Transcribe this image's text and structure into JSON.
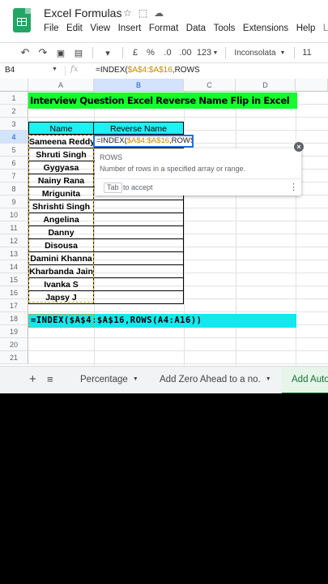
{
  "app": {
    "title": "Excel Formulas",
    "menu": [
      "File",
      "Edit",
      "View",
      "Insert",
      "Format",
      "Data",
      "Tools",
      "Extensions",
      "Help",
      "L"
    ]
  },
  "toolbar": {
    "pound": "£",
    "percent": "%",
    "dec_decrease": ".0",
    "dec_increase": ".00",
    "more_formats": "123",
    "font": "Inconsolata",
    "font_size": "11"
  },
  "formula_bar": {
    "name_box": "B4",
    "fx": "fx",
    "prefix": "=INDEX(",
    "range": "$A$4:$A$16",
    "suffix": ",ROWS"
  },
  "columns": [
    "A",
    "B",
    "C",
    "D"
  ],
  "rows": [
    "1",
    "2",
    "3",
    "4",
    "5",
    "6",
    "7",
    "8",
    "9",
    "10",
    "11",
    "12",
    "13",
    "14",
    "15",
    "16",
    "17",
    "18",
    "19",
    "20",
    "21"
  ],
  "sheet": {
    "banner": "Interview Question Excel Reverse Name Flip in Excel",
    "header_name": "Name",
    "header_reverse": "Reverse Name",
    "names": [
      "Sameena Reddy",
      "Shruti Singh",
      "Gygyasa",
      "Nainy Rana",
      "Mrigunita",
      "Shrishti Singh",
      "Angelina",
      "Danny",
      "Disousa",
      "Damini Khanna",
      "Kharbanda Jain",
      "Ivanka S",
      "Japsy J"
    ],
    "formula_text": "=INDEX($A$4:$A$16,ROWS(A4:A16))"
  },
  "tooltip": {
    "name": "ROWS",
    "description": "Number of rows in a specified array or range.",
    "key": "Tab",
    "accept": "to accept"
  },
  "tabs": [
    {
      "label": "Percentage",
      "active": false
    },
    {
      "label": "Add Zero Ahead to a no.",
      "active": false
    },
    {
      "label": "Add Auto",
      "active": true
    }
  ]
}
